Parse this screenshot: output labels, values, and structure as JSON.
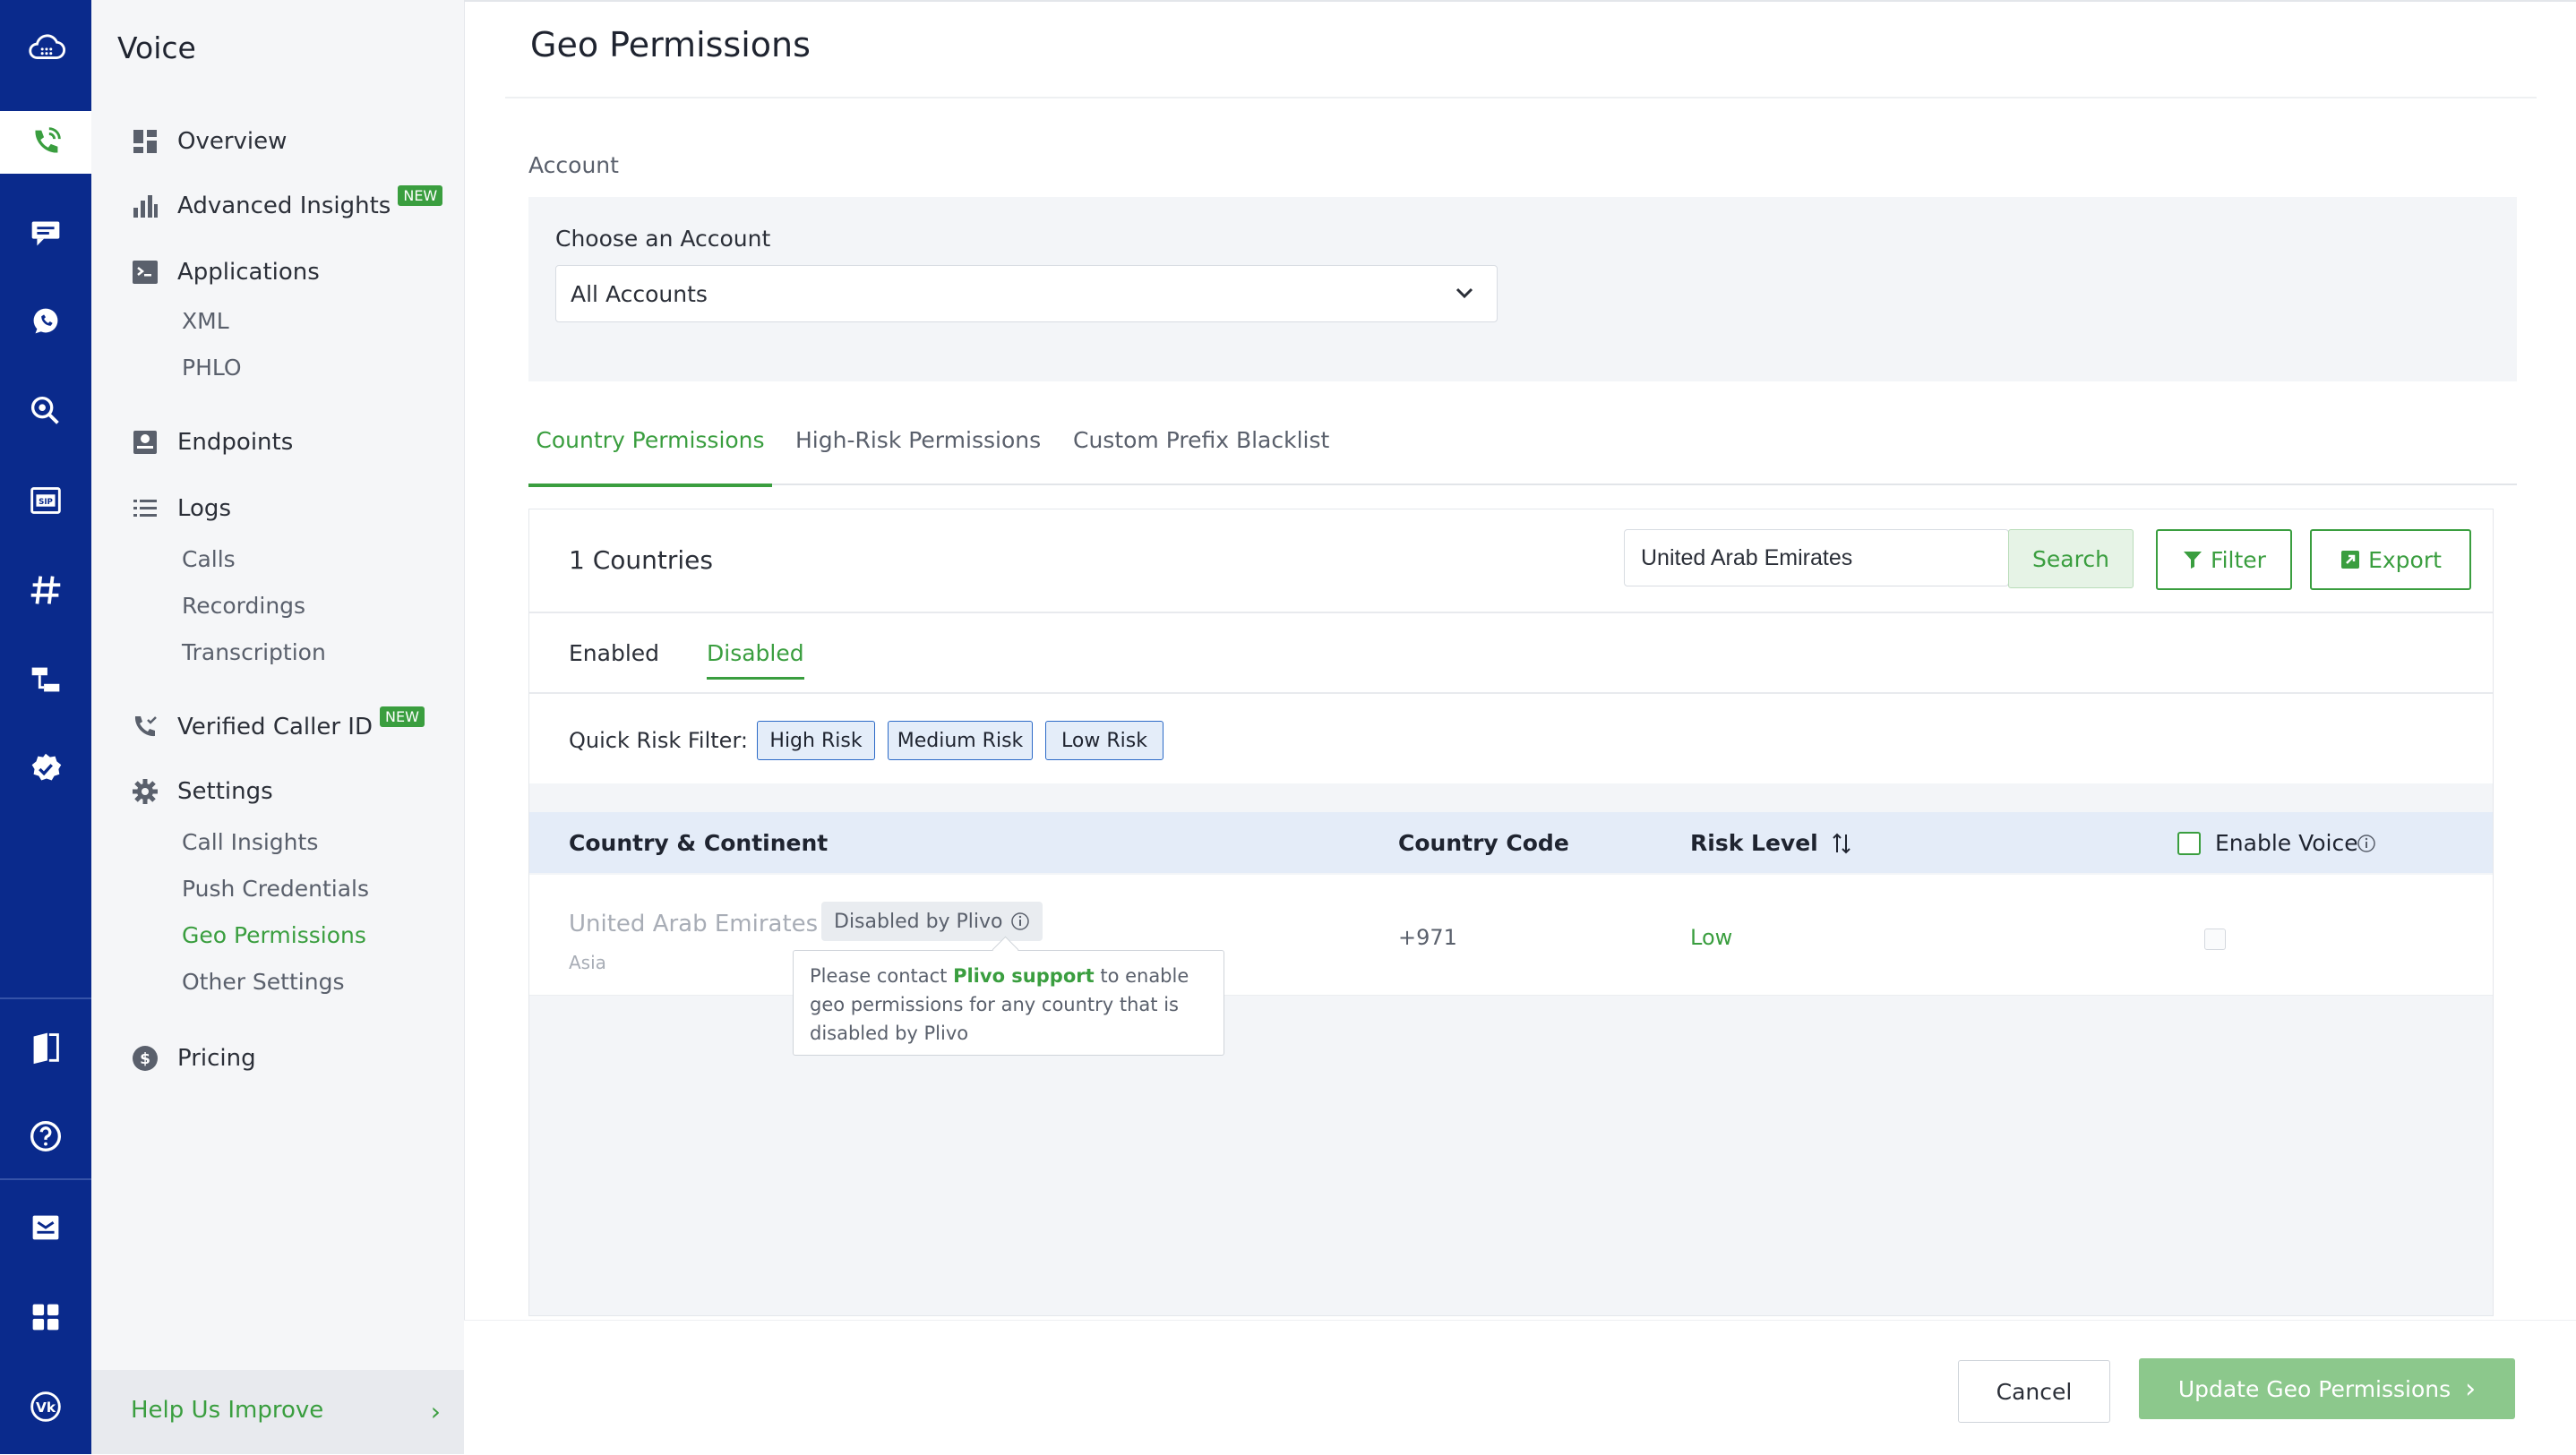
{
  "nav": {
    "title": "Voice",
    "items": [
      {
        "label": "Overview"
      },
      {
        "label": "Advanced Insights",
        "badge": "NEW"
      },
      {
        "label": "Applications"
      },
      {
        "label": "Endpoints"
      },
      {
        "label": "Logs"
      },
      {
        "label": "Verified Caller ID",
        "badge": "NEW"
      },
      {
        "label": "Settings"
      },
      {
        "label": "Pricing"
      }
    ],
    "applications_sub": [
      "XML",
      "PHLO"
    ],
    "logs_sub": [
      "Calls",
      "Recordings",
      "Transcription"
    ],
    "settings_sub": [
      "Call Insights",
      "Push Credentials",
      "Geo Permissions",
      "Other Settings"
    ],
    "help": "Help Us Improve"
  },
  "page": {
    "title": "Geo Permissions",
    "account_label": "Account",
    "choose_label": "Choose an Account",
    "account_value": "All Accounts"
  },
  "tabs": [
    "Country Permissions",
    "High-Risk Permissions",
    "Custom Prefix Blacklist"
  ],
  "toolbar": {
    "count": "1 Countries",
    "search_value": "United Arab Emirates",
    "search_label": "Search",
    "filter_label": "Filter",
    "export_label": "Export"
  },
  "subtabs": [
    "Enabled",
    "Disabled"
  ],
  "quick_filter": {
    "label": "Quick Risk Filter:",
    "options": [
      "High Risk",
      "Medium Risk",
      "Low Risk"
    ]
  },
  "table": {
    "headers": [
      "Country & Continent",
      "Country Code",
      "Risk Level",
      "Enable Voice"
    ],
    "rows": [
      {
        "country": "United Arab Emirates",
        "continent": "Asia",
        "badge": "Disabled by Plivo",
        "code": "+971",
        "risk": "Low"
      }
    ]
  },
  "tooltip": {
    "pre": "Please contact ",
    "link": "Plivo support",
    "post": " to enable geo permissions for any country that is disabled by Plivo"
  },
  "footer": {
    "cancel": "Cancel",
    "update": "Update Geo Permissions"
  },
  "colors": {
    "accent": "#3a9e3f",
    "rail": "#0a2a8c"
  }
}
